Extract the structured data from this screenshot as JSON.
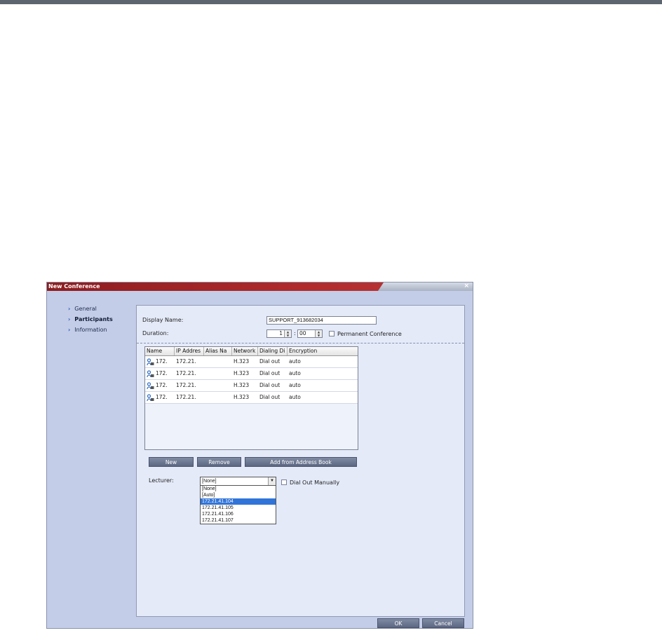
{
  "dialog": {
    "title": "New Conference",
    "close": "×"
  },
  "nav": {
    "items": [
      {
        "label": "General",
        "active": false
      },
      {
        "label": "Participants",
        "active": true
      },
      {
        "label": "Information",
        "active": false
      }
    ]
  },
  "form": {
    "display_name_label": "Display Name:",
    "display_name_value": "SUPPORT_913682034",
    "duration_label": "Duration:",
    "duration_hours": "1",
    "duration_sep": ":",
    "duration_minutes": "00",
    "permanent_label": "Permanent Conference"
  },
  "grid": {
    "headers": [
      "Name",
      "IP Addres",
      "Alias Na",
      "Network",
      "Dialing Di",
      "Encryption"
    ],
    "rows": [
      [
        "172.",
        "172.21.",
        "",
        "H.323",
        "Dial out",
        "auto"
      ],
      [
        "172.",
        "172.21.",
        "",
        "H.323",
        "Dial out",
        "auto"
      ],
      [
        "172.",
        "172.21.",
        "",
        "H.323",
        "Dial out",
        "auto"
      ],
      [
        "172.",
        "172.21.",
        "",
        "H.323",
        "Dial out",
        "auto"
      ]
    ]
  },
  "buttons": {
    "new": "New",
    "remove": "Remove",
    "add_from_address_book": "Add from Address Book",
    "ok": "OK",
    "cancel": "Cancel"
  },
  "lecturer": {
    "label": "Lecturer:",
    "selected": "[None]",
    "dial_out_manually": "Dial Out Manually",
    "options": [
      "[None]",
      "[Auto]",
      "172.21.41.104",
      "172.21.41.105",
      "172.21.41.106",
      "172.21.41.107"
    ],
    "highlighted_index": 2
  }
}
